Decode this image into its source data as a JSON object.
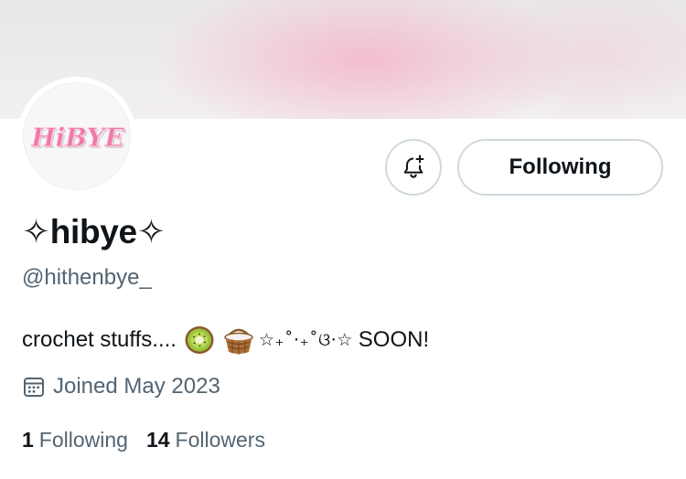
{
  "profile": {
    "avatar_text": "HiBYE",
    "display_name": "✧hibye✧",
    "handle": "@hithenbye_",
    "bio_text": "crochet stuffs....",
    "bio_decoration": "☆₊˚⋅₊˚ଓ·☆",
    "bio_soon": "SOON!",
    "joined": "Joined May 2023"
  },
  "actions": {
    "notify_icon": "bell-plus-icon",
    "following_label": "Following"
  },
  "stats": {
    "following_count": "1",
    "following_label": "Following",
    "followers_count": "14",
    "followers_label": "Followers"
  },
  "colors": {
    "text_primary": "#0f1419",
    "text_secondary": "#536471",
    "border": "#cfd9de",
    "banner_pink": "#f3bace",
    "avatar_pink": "#f07aa8"
  }
}
